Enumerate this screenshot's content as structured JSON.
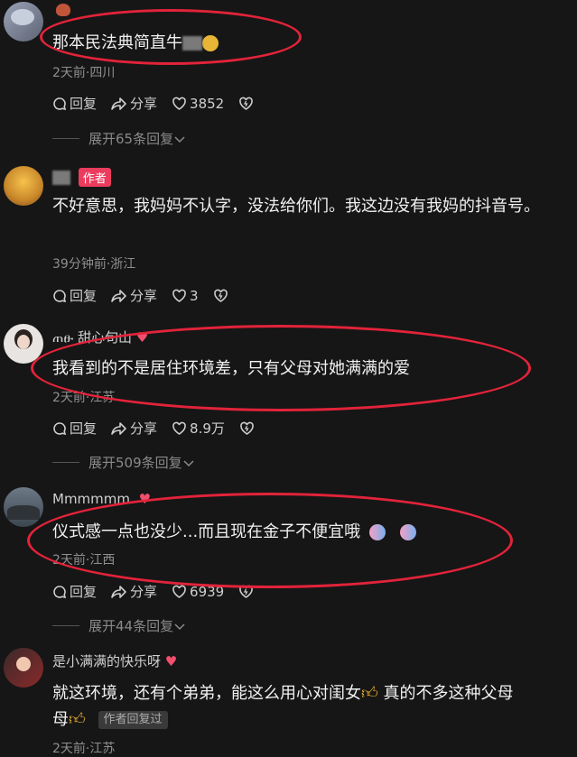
{
  "comments": [
    {
      "text": "那本民法典简直牛",
      "meta": "2天前·四川",
      "reply": "回复",
      "share": "分享",
      "likes": "3852",
      "expand": "展开65条回复"
    },
    {
      "author_badge": "作者",
      "text": "不好意思，我妈妈不认字，没法给你们。我这边没有我妈的抖音号。",
      "meta": "39分钟前·浙江",
      "reply": "回复",
      "share": "分享",
      "likes": "3"
    },
    {
      "name": "ጠፁ 甜心旬山",
      "text": "我看到的不是居住环境差，只有父母对她满满的爱",
      "meta": "2天前·江苏",
      "reply": "回复",
      "share": "分享",
      "likes": "8.9万",
      "expand": "展开509条回复"
    },
    {
      "name": "Mmmmmm.",
      "text": "仪式感一点也没少...而且现在金子不便宜哦",
      "meta": "2天前·江西",
      "reply": "回复",
      "share": "分享",
      "likes": "6939",
      "expand": "展开44条回复"
    },
    {
      "name": "是小满满的快乐呀",
      "text": "就这环境，还有个弟弟，能这么用心对闺女",
      "text2": "真的不多这种父母",
      "reply_badge": "作者回复过",
      "meta": "2天前·江苏"
    }
  ],
  "colors": {
    "highlight": "#e2233a",
    "author_badge": "#ec3c5e",
    "background": "#161616"
  },
  "icons": [
    "reply-bubble-icon",
    "share-arrow-icon",
    "heart-icon",
    "dislike-heart-icon",
    "chevron-down-icon"
  ]
}
